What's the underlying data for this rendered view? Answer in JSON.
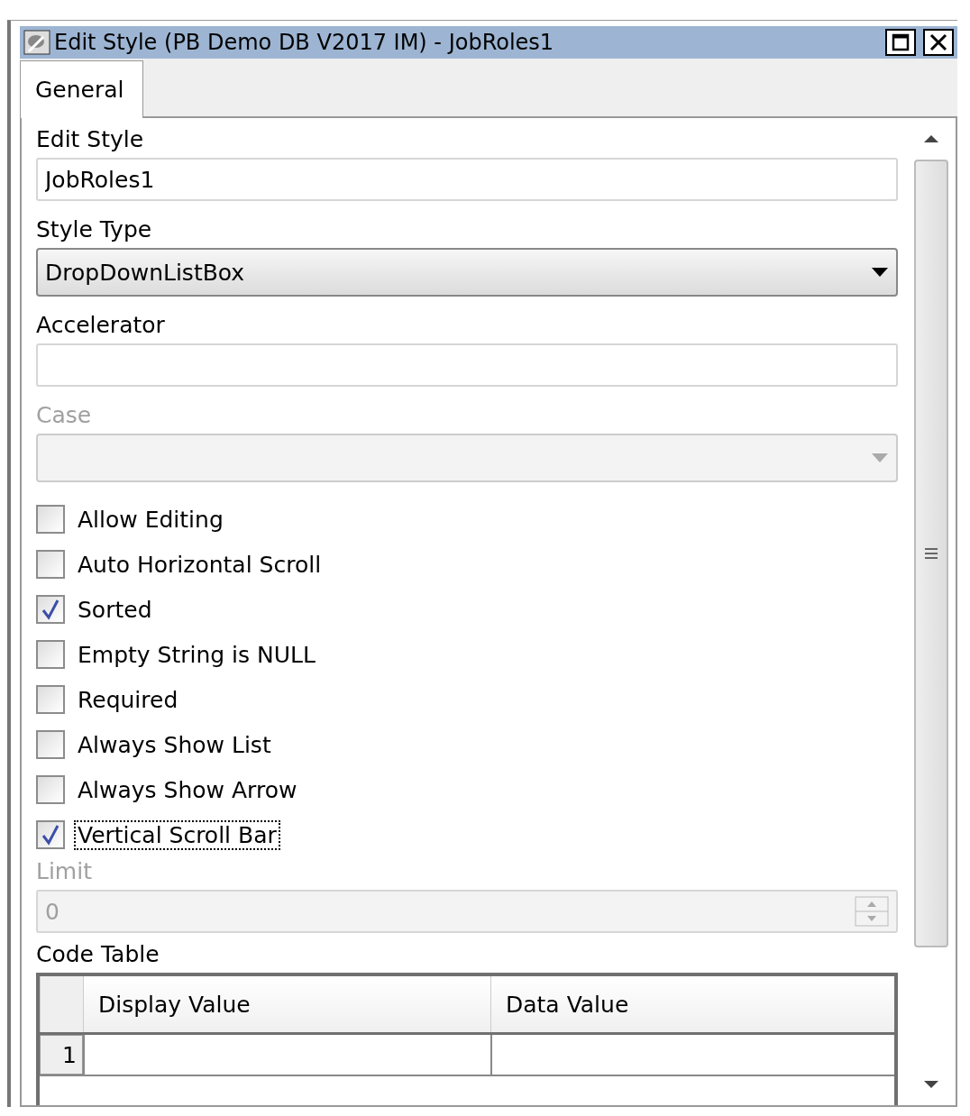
{
  "window": {
    "title": "Edit Style (PB Demo DB V2017 IM) - JobRoles1"
  },
  "tabs": [
    {
      "label": "General",
      "selected": true
    }
  ],
  "fields": [
    {
      "kind": "text",
      "label": "Edit Style",
      "value": "JobRoles1",
      "disabled": false
    },
    {
      "kind": "dropdown",
      "label": "Style Type",
      "value": "DropDownListBox",
      "disabled": false
    },
    {
      "kind": "text",
      "label": "Accelerator",
      "disabled": false
    },
    {
      "kind": "dropdown",
      "label": "Case",
      "disabled": true
    },
    {
      "kind": "checkbox",
      "label": "Allow Editing",
      "checked": false,
      "focused": false
    },
    {
      "kind": "checkbox",
      "label": "Auto Horizontal Scroll",
      "checked": false,
      "focused": false
    },
    {
      "kind": "checkbox",
      "label": "Sorted",
      "checked": true,
      "focused": false
    },
    {
      "kind": "checkbox",
      "label": "Empty String is NULL",
      "checked": false,
      "focused": false
    },
    {
      "kind": "checkbox",
      "label": "Required",
      "checked": false,
      "focused": false
    },
    {
      "kind": "checkbox",
      "label": "Always Show List",
      "checked": false,
      "focused": false
    },
    {
      "kind": "checkbox",
      "label": "Always Show Arrow",
      "checked": false,
      "focused": false
    },
    {
      "kind": "checkbox",
      "label": "Vertical Scroll Bar",
      "checked": true,
      "focused": true
    },
    {
      "kind": "spinner",
      "label": "Limit",
      "value": "0",
      "disabled": true
    }
  ],
  "code_table": {
    "label": "Code Table",
    "columns": [
      "Display Value",
      "Data Value"
    ],
    "rows": [
      {
        "number": "1"
      }
    ]
  }
}
